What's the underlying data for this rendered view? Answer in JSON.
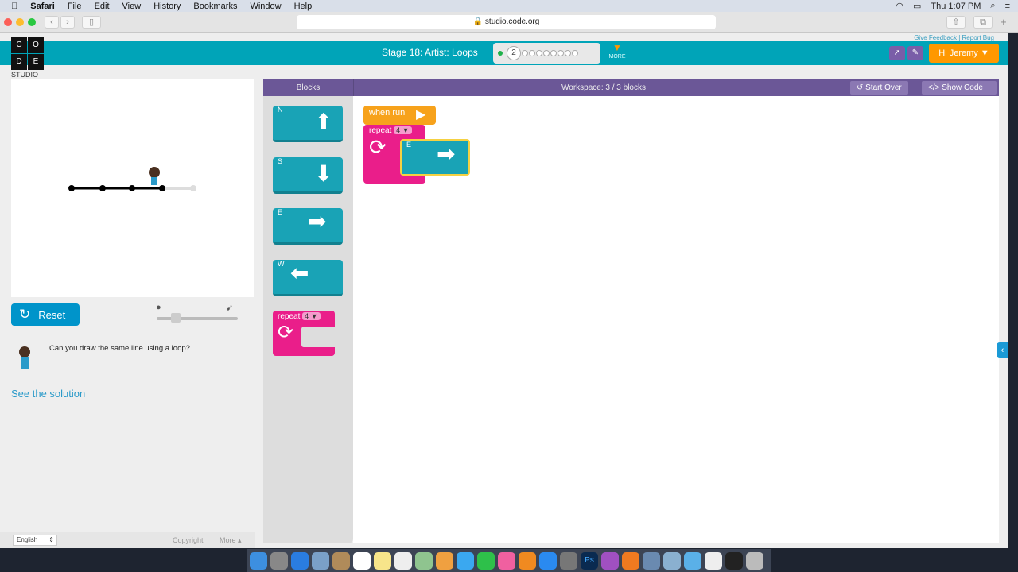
{
  "menubar": {
    "app": "Safari",
    "items": [
      "File",
      "Edit",
      "View",
      "History",
      "Bookmarks",
      "Window",
      "Help"
    ],
    "clock": "Thu 1:07 PM"
  },
  "browser": {
    "url": "studio.code.org"
  },
  "header": {
    "logo_letters": [
      "C",
      "O",
      "D",
      "E"
    ],
    "logo_sub": "STUDIO",
    "feedback": "Give Feedback",
    "report": "Report Bug",
    "stage": "Stage 18: Artist: Loops",
    "current_level": "2",
    "more": "MORE",
    "user": "Hi Jeremy ▼"
  },
  "left": {
    "reset": "Reset",
    "instruction": "Can you draw the same line using a loop?",
    "solution": "See the solution"
  },
  "editor": {
    "blocks_title": "Blocks",
    "workspace_title": "Workspace: 3 / 3 blocks",
    "start_over": "Start Over",
    "show_code": "Show Code"
  },
  "toolbox": {
    "n": "N",
    "s": "S",
    "e": "E",
    "w": "W",
    "repeat": "repeat",
    "count": "4 ▼"
  },
  "workspace": {
    "when_run": "when run",
    "repeat": "repeat",
    "count": "4 ▼",
    "e": "E"
  },
  "footer": {
    "language": "English",
    "copyright": "Copyright",
    "more": "More ▴"
  },
  "colors": {
    "teal": "#00a4b8",
    "purple": "#6b5797",
    "orange": "#ff9800",
    "pink": "#ea1e8a"
  }
}
